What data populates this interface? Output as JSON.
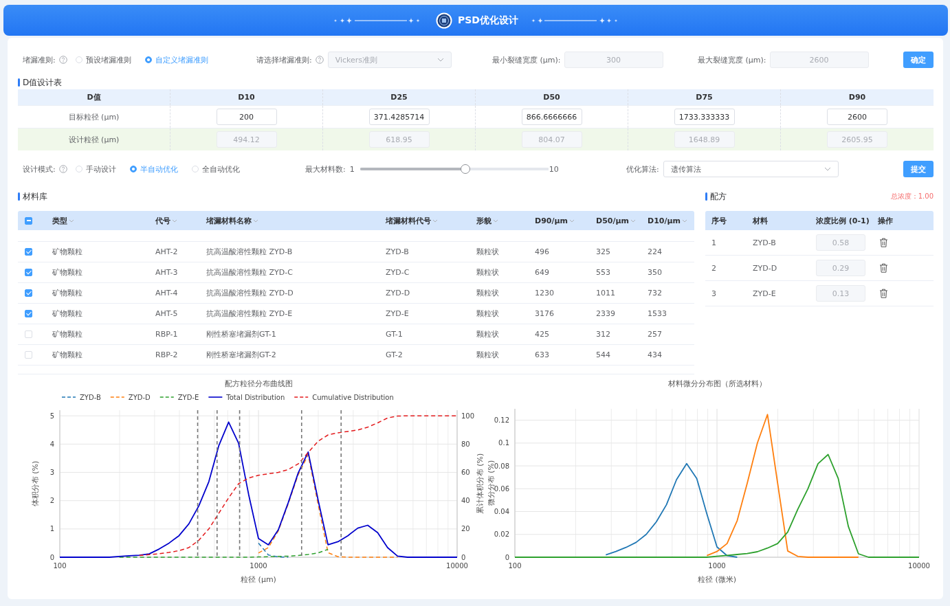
{
  "header": {
    "title": "PSD优化设计"
  },
  "criteria": {
    "label": "堵漏准则:",
    "options": [
      {
        "label": "预设堵漏准则",
        "selected": false
      },
      {
        "label": "自定义堵漏准则",
        "selected": true
      }
    ],
    "select_label": "请选择堵漏准则:",
    "select": {
      "value": "Vickers准则",
      "disabled": true
    },
    "min": {
      "label": "最小裂缝宽度 (μm):",
      "value": "300",
      "disabled": true
    },
    "max": {
      "label": "最大裂缝宽度 (μm):",
      "value": "2600",
      "disabled": true
    },
    "button": "确定"
  },
  "d_table": {
    "title": "D值设计表",
    "columns": [
      "D值",
      "D10",
      "D25",
      "D50",
      "D75",
      "D90"
    ],
    "rows": [
      {
        "label": "目标粒径 (μm)",
        "kind": "target",
        "disabled": false,
        "values": [
          "200",
          "371.4285714",
          "866.6666666",
          "1733.333333",
          "2600"
        ]
      },
      {
        "label": "设计粒径 (μm)",
        "kind": "design",
        "disabled": true,
        "values": [
          "494.12",
          "618.95",
          "804.07",
          "1648.89",
          "2605.95"
        ]
      }
    ]
  },
  "mode": {
    "label": "设计模式:",
    "options": [
      {
        "label": "手动设计",
        "selected": false
      },
      {
        "label": "半自动优化",
        "selected": true
      },
      {
        "label": "全自动优化",
        "selected": false
      }
    ],
    "max_label": "最大材料数:",
    "min_text": "1",
    "max_text": "10",
    "level": 0.56,
    "algo_label": "优化算法:",
    "algo": {
      "value": "遗传算法",
      "disabled": false
    },
    "button": "提交"
  },
  "materials": {
    "title": "材料库",
    "select_all": {
      "indeterminate": true
    },
    "columns": [
      "类型",
      "代号",
      "堵漏材料名称",
      "堵漏材料代号",
      "形貌",
      "D90/μm",
      "D50/μm",
      "D10/μm"
    ],
    "rows": [
      {
        "checked": true,
        "cells": [
          "矿物颗粒",
          "AHT-2",
          "抗高温酸溶性颗粒 ZYD-B",
          "ZYD-B",
          "颗粒状",
          "496",
          "325",
          "224"
        ]
      },
      {
        "checked": true,
        "cells": [
          "矿物颗粒",
          "AHT-3",
          "抗高温酸溶性颗粒 ZYD-C",
          "ZYD-C",
          "颗粒状",
          "649",
          "553",
          "350"
        ]
      },
      {
        "checked": true,
        "cells": [
          "矿物颗粒",
          "AHT-4",
          "抗高温酸溶性颗粒 ZYD-D",
          "ZYD-D",
          "颗粒状",
          "1230",
          "1011",
          "732"
        ]
      },
      {
        "checked": true,
        "cells": [
          "矿物颗粒",
          "AHT-5",
          "抗高温酸溶性颗粒 ZYD-E",
          "ZYD-E",
          "颗粒状",
          "3176",
          "2339",
          "1533"
        ]
      },
      {
        "checked": false,
        "cells": [
          "矿物颗粒",
          "RBP-1",
          "刚性桥塞堵漏剂GT-1",
          "GT-1",
          "颗粒状",
          "425",
          "312",
          "257"
        ]
      },
      {
        "checked": false,
        "cells": [
          "矿物颗粒",
          "RBP-2",
          "刚性桥塞堵漏剂GT-2",
          "GT-2",
          "颗粒状",
          "633",
          "544",
          "434"
        ]
      }
    ]
  },
  "formula": {
    "title": "配方",
    "total": "总浓度：1.00",
    "columns": [
      "序号",
      "材料",
      "浓度比例 (0-1)",
      "操作"
    ],
    "rows": [
      {
        "index": "1",
        "material": "ZYD-B",
        "ratio": "0.58",
        "disabled": true
      },
      {
        "index": "2",
        "material": "ZYD-D",
        "ratio": "0.29",
        "disabled": true
      },
      {
        "index": "3",
        "material": "ZYD-E",
        "ratio": "0.13",
        "disabled": true
      }
    ]
  },
  "charts": [
    {
      "show_design_lines": true,
      "chart_data": {
        "type": "line",
        "title": "配方粒径分布曲线图",
        "xlabel": "粒径 (μm)",
        "ylabel": "体积分布 (%)",
        "y2label": "累计体积分布 (%)",
        "grid": true,
        "legend": "top",
        "categories": [
          "100",
          null,
          null,
          null,
          null,
          null,
          null,
          null,
          null,
          null,
          null,
          null,
          null,
          null,
          null,
          null,
          null,
          null,
          null,
          null,
          "1000",
          null,
          null,
          null,
          null,
          null,
          null,
          null,
          null,
          null,
          null,
          null,
          null,
          null,
          null,
          null,
          null,
          null,
          null,
          null,
          "10000"
        ],
        "series": [
          {
            "name": "ZYD-B",
            "color": "#1f77b4",
            "line_style": "dashed",
            "values": [
              null,
              null,
              null,
              null,
              null,
              null,
              null,
              null,
              null,
              null,
              null,
              null,
              null,
              null,
              null,
              null,
              null,
              null,
              null,
              null,
              0.5,
              0.08,
              0.01,
              0,
              null,
              null,
              null,
              null,
              null,
              null,
              null,
              null,
              null,
              null,
              null,
              null,
              null,
              null,
              null,
              null,
              null
            ]
          },
          {
            "name": "ZYD-D",
            "color": "#ff7f0e",
            "line_style": "dashed",
            "values": [
              null,
              null,
              null,
              null,
              null,
              null,
              null,
              null,
              null,
              null,
              null,
              null,
              null,
              null,
              null,
              null,
              null,
              null,
              null,
              null,
              0.15,
              0.34,
              0.93,
              1.89,
              2.92,
              3.62,
              1.88,
              0.16,
              0.02,
              0,
              0,
              0,
              0,
              0,
              0,
              null,
              null,
              null,
              null,
              null,
              null
            ]
          },
          {
            "name": "ZYD-E",
            "color": "#2ca02c",
            "line_style": "dashed",
            "values": [
              null,
              null,
              null,
              null,
              null,
              null,
              0,
              0,
              0,
              0,
              0,
              0,
              0,
              0,
              0,
              0,
              0,
              0,
              0,
              0,
              0.01,
              0.02,
              0.03,
              0.04,
              0.06,
              0.1,
              0.15,
              0.28,
              null,
              null,
              null,
              null,
              null,
              null,
              null,
              null,
              null,
              null,
              null,
              null,
              null
            ]
          },
          {
            "name": "Total Distribution",
            "color": "#0000cc",
            "line_style": "solid",
            "values": [
              0,
              0,
              0,
              0,
              0,
              0,
              0.03,
              0.05,
              0.07,
              0.12,
              0.29,
              0.5,
              0.76,
              1.18,
              1.82,
              2.67,
              3.94,
              4.78,
              4.03,
              2.23,
              0.66,
              0.44,
              0.97,
              1.93,
              2.98,
              3.72,
              2.03,
              0.44,
              0.55,
              0.76,
              1.03,
              1.13,
              0.87,
              0.34,
              0.04,
              0,
              0,
              0,
              0,
              0,
              0
            ]
          },
          {
            "name": "Cumulative Distribution",
            "color": "#e31a1c",
            "line_style": "dashed",
            "axis": "y2",
            "values": [
              null,
              null,
              null,
              null,
              null,
              null,
              null,
              null,
              1.2,
              1.8,
              2.5,
              3.4,
              4.6,
              6.8,
              12,
              20,
              31,
              42,
              52,
              56,
              58,
              59,
              60,
              62,
              66,
              74,
              82,
              86.5,
              88,
              89,
              90,
              92,
              95,
              98.5,
              99.8,
              100,
              100,
              100,
              100,
              100,
              100
            ]
          }
        ],
        "ylim": [
          0,
          5.2
        ],
        "y2lim": [
          0,
          104
        ],
        "yticks": [
          0,
          1,
          2,
          3,
          4,
          5
        ],
        "y2ticks": [
          0,
          20,
          40,
          60,
          80,
          100
        ]
      }
    },
    {
      "chart_data": {
        "type": "line",
        "title": "材料微分分布图（所选材料）",
        "xlabel": "粒径 (微米)",
        "ylabel": "微分分布 (%)",
        "grid": true,
        "categories": [
          "100",
          null,
          null,
          null,
          null,
          null,
          null,
          null,
          null,
          null,
          null,
          null,
          null,
          null,
          null,
          null,
          null,
          null,
          null,
          null,
          "1000",
          null,
          null,
          null,
          null,
          null,
          null,
          null,
          null,
          null,
          null,
          null,
          null,
          null,
          null,
          null,
          null,
          null,
          null,
          null,
          "10000"
        ],
        "series": [
          {
            "color": "#1f77b4",
            "line_style": "solid",
            "values": [
              null,
              null,
              null,
              null,
              null,
              null,
              null,
              null,
              null,
              0.002,
              0.005,
              0.0086,
              0.013,
              0.02,
              0.031,
              0.046,
              0.068,
              0.082,
              0.069,
              0.038,
              0.009,
              0.0014,
              0,
              null,
              null,
              null,
              null,
              null,
              null,
              null,
              null,
              null,
              null,
              null,
              null,
              null,
              null,
              null,
              null,
              null,
              null
            ]
          },
          {
            "color": "#ff7f0e",
            "line_style": "solid",
            "values": [
              null,
              null,
              null,
              null,
              null,
              null,
              null,
              null,
              null,
              null,
              null,
              null,
              null,
              null,
              null,
              null,
              null,
              null,
              null,
              0.0014,
              0.005,
              0.012,
              0.032,
              0.065,
              0.1,
              0.125,
              0.065,
              0.0055,
              0.0007,
              0,
              0,
              0,
              0,
              0,
              0,
              null,
              null,
              null,
              null,
              null,
              null
            ]
          },
          {
            "color": "#2ca02c",
            "line_style": "solid",
            "values": [
              0,
              0,
              0,
              0,
              0,
              0,
              0,
              0,
              0,
              0,
              0,
              0,
              0,
              0,
              0,
              0,
              0,
              0,
              0,
              0,
              0.0008,
              0.0016,
              0.0024,
              0.0032,
              0.0048,
              0.008,
              0.012,
              0.022,
              0.042,
              0.06,
              0.082,
              0.09,
              0.069,
              0.027,
              0.003,
              0,
              0,
              0,
              0,
              0,
              0
            ]
          }
        ],
        "ylim": [
          0,
          0.13
        ],
        "yticks": [
          0,
          0.02,
          0.04,
          0.06,
          0.08,
          0.1,
          0.12
        ]
      }
    }
  ]
}
